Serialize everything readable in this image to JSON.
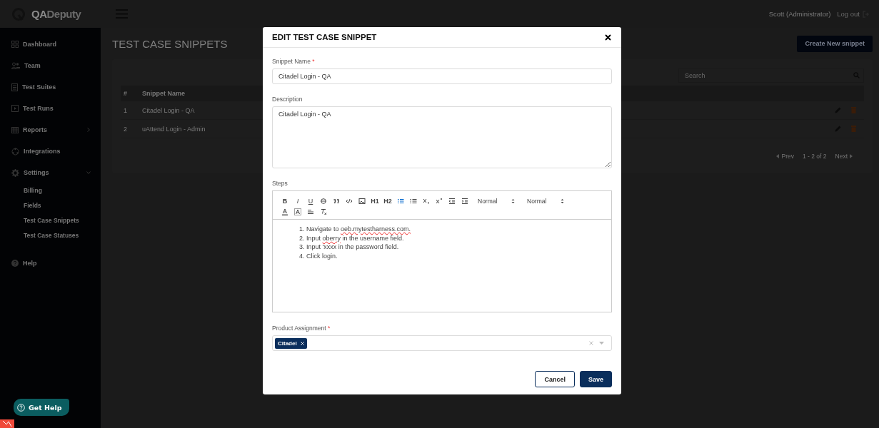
{
  "header": {
    "logo_bold": "QA",
    "logo_light": "Deputy",
    "user": "Scott (Administrator)",
    "logout": "Log out"
  },
  "sidebar": {
    "items": [
      {
        "label": "Dashboard",
        "kind": "dashboard"
      },
      {
        "label": "Team",
        "kind": "team"
      },
      {
        "label": "Test Suites",
        "kind": "suites"
      },
      {
        "label": "Test Runs",
        "kind": "runs"
      },
      {
        "label": "Reports",
        "kind": "reports",
        "expanded": false
      },
      {
        "label": "Integrations",
        "kind": "integrations"
      },
      {
        "label": "Settings",
        "kind": "settings",
        "expanded": true,
        "children": [
          {
            "label": "Billing"
          },
          {
            "label": "Fields"
          },
          {
            "label": "Test Case Snippets"
          },
          {
            "label": "Test Case Statuses"
          }
        ]
      },
      {
        "label": "Help",
        "kind": "help"
      }
    ],
    "get_help": "Get Help"
  },
  "page": {
    "title": "TEST CASE SNIPPETS",
    "create_button": "Create New snippet",
    "search": {
      "placeholder": "Search"
    },
    "table": {
      "columns": [
        "#",
        "Snippet Name"
      ],
      "rows": [
        [
          "1",
          "Citadel Login - QA"
        ],
        [
          "2",
          "uAttend Login - Admin"
        ]
      ]
    },
    "pagination": {
      "prev": "Prev",
      "range": "1 - 2 of 2",
      "next": "Next"
    }
  },
  "modal": {
    "title": "EDIT TEST CASE SNIPPET",
    "snippet_name": {
      "label": "Snippet Name",
      "required_mark": "*",
      "value": "Citadel Login - QA"
    },
    "description": {
      "label": "Description",
      "value": "Citadel Login - QA"
    },
    "steps": {
      "label": "Steps",
      "toolbar": [
        {
          "kind": "bold",
          "label": "B",
          "active": false
        },
        {
          "kind": "italic",
          "label": "I",
          "active": false
        },
        {
          "kind": "underline",
          "label": "U",
          "active": false
        },
        {
          "kind": "strike",
          "active": false
        },
        {
          "kind": "quote",
          "active": false
        },
        {
          "kind": "code",
          "active": false
        },
        {
          "kind": "image",
          "active": false
        },
        {
          "kind": "h1",
          "label": "H1",
          "active": false
        },
        {
          "kind": "h2",
          "label": "H2",
          "active": false
        },
        {
          "kind": "ordered",
          "active": true
        },
        {
          "kind": "bullet",
          "active": false
        },
        {
          "kind": "sub",
          "active": false
        },
        {
          "kind": "sup",
          "active": false
        },
        {
          "kind": "outdent",
          "active": false
        },
        {
          "kind": "indent",
          "active": false
        },
        {
          "kind": "select",
          "label": "Normal"
        },
        {
          "kind": "select",
          "label": "Normal"
        },
        {
          "kind": "break"
        },
        {
          "kind": "color",
          "active": false
        },
        {
          "kind": "background",
          "active": false
        },
        {
          "kind": "align",
          "active": false
        },
        {
          "kind": "clean",
          "active": false
        }
      ],
      "lines": [
        {
          "number": "1.",
          "parts": [
            {
              "text": "Navigate to ",
              "misspelled": false
            },
            {
              "text": "oeb.mytestharness.com.",
              "misspelled": true
            }
          ]
        },
        {
          "number": "2.",
          "parts": [
            {
              "text": "Input ",
              "misspelled": false
            },
            {
              "text": "oberry",
              "misspelled": true
            },
            {
              "text": " in the username field.",
              "misspelled": false
            }
          ]
        },
        {
          "number": "3.",
          "parts": [
            {
              "text": "Input 'xxxx in the password field.",
              "misspelled": false
            }
          ]
        },
        {
          "number": "4.",
          "parts": [
            {
              "text": "Click login.",
              "misspelled": false
            }
          ]
        }
      ]
    },
    "product": {
      "label": "Product Assignment",
      "required_mark": "*",
      "tags": [
        "Citadel"
      ]
    },
    "buttons": [
      {
        "kind": "secondary",
        "label": "Cancel"
      },
      {
        "kind": "primary",
        "label": "Save"
      }
    ]
  }
}
